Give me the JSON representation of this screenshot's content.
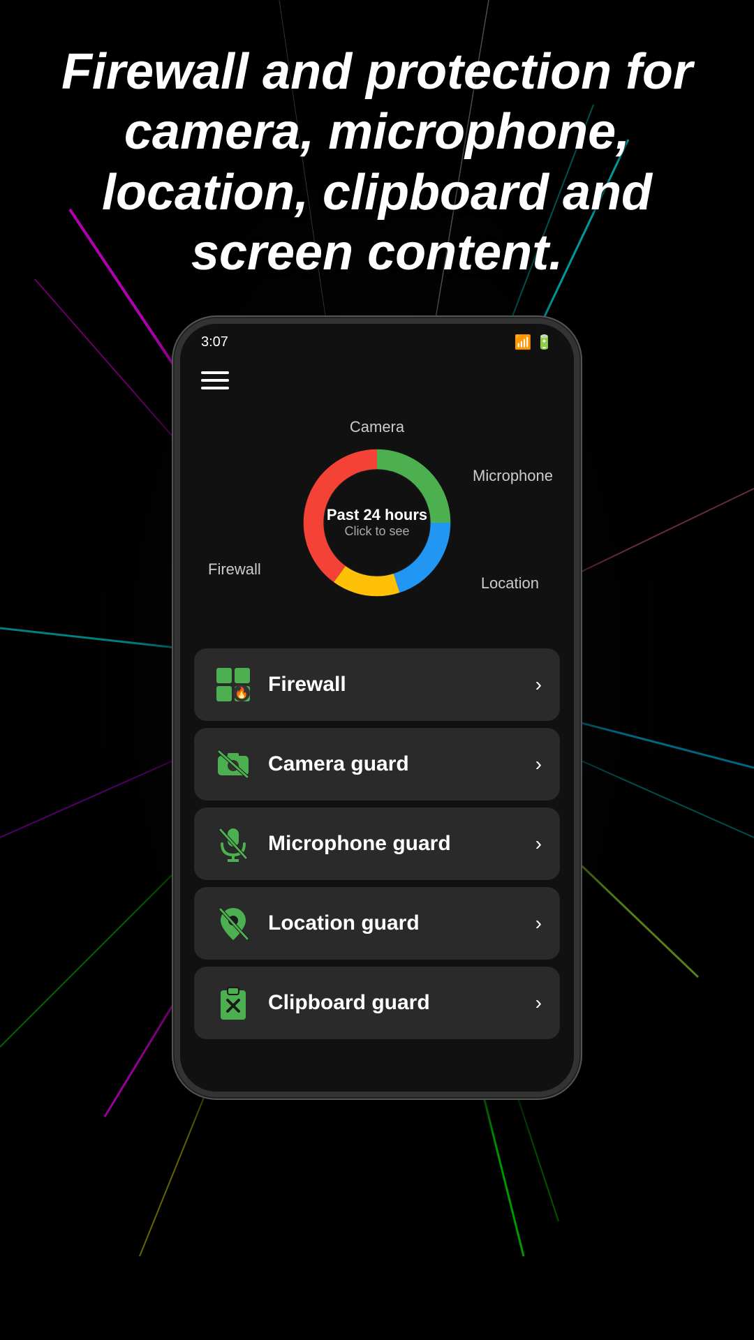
{
  "hero": {
    "text": "Firewall and protection for camera, microphone, location, clipboard and screen content."
  },
  "phone": {
    "status_bar": {
      "time": "3:07",
      "signal": "▌▌▌"
    },
    "chart": {
      "title": "Past 24 hours",
      "subtitle": "Click to see",
      "labels": {
        "camera": "Camera",
        "microphone": "Microphone",
        "firewall": "Firewall",
        "location": "Location"
      },
      "segments": [
        {
          "label": "Camera",
          "color": "#4caf50",
          "percent": 25
        },
        {
          "label": "Microphone",
          "color": "#2196f3",
          "percent": 20
        },
        {
          "label": "Location",
          "color": "#ffc107",
          "percent": 15
        },
        {
          "label": "Firewall",
          "color": "#f44336",
          "percent": 40
        }
      ]
    },
    "menu_items": [
      {
        "id": "firewall",
        "label": "Firewall",
        "icon": "firewall"
      },
      {
        "id": "camera-guard",
        "label": "Camera guard",
        "icon": "camera"
      },
      {
        "id": "microphone-guard",
        "label": "Microphone guard",
        "icon": "microphone"
      },
      {
        "id": "location-guard",
        "label": "Location guard",
        "icon": "location"
      },
      {
        "id": "clipboard-guard",
        "label": "Clipboard guard",
        "icon": "clipboard"
      }
    ]
  },
  "colors": {
    "green": "#4caf50",
    "blue": "#2196f3",
    "yellow": "#ffc107",
    "red": "#f44336",
    "accent": "#4caf50"
  }
}
